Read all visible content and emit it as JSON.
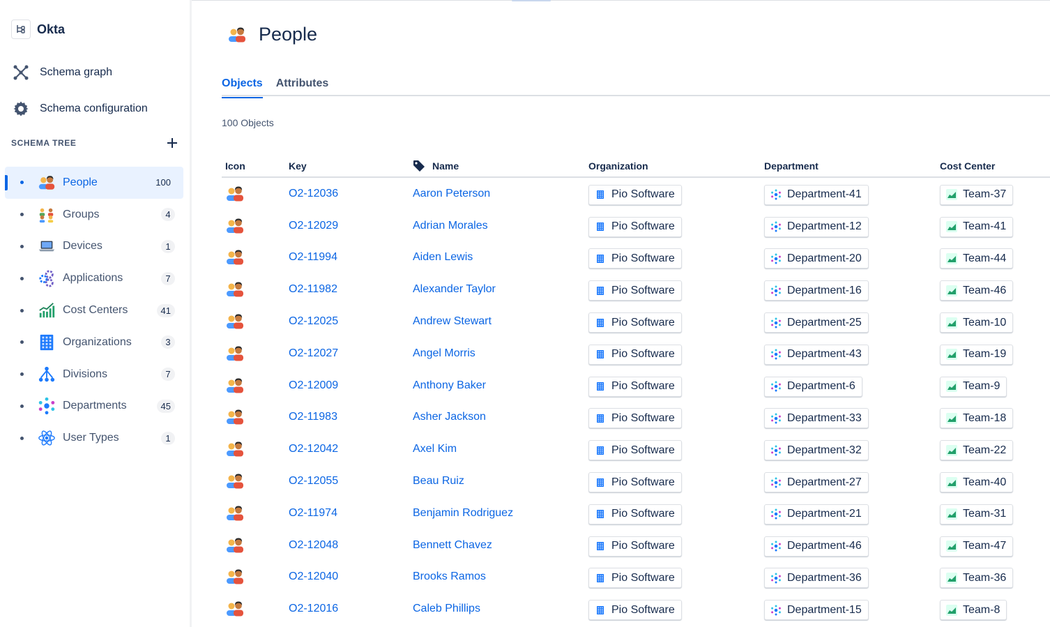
{
  "app": {
    "title": "Okta"
  },
  "nav": [
    {
      "label": "Schema graph",
      "icon": "schema-graph-icon"
    },
    {
      "label": "Schema configuration",
      "icon": "gear-icon"
    }
  ],
  "schema_tree": {
    "title": "SCHEMA TREE",
    "items": [
      {
        "label": "People",
        "count": "100",
        "icon": "people-icon",
        "active": true
      },
      {
        "label": "Groups",
        "count": "4",
        "icon": "groups-icon"
      },
      {
        "label": "Devices",
        "count": "1",
        "icon": "laptop-icon"
      },
      {
        "label": "Applications",
        "count": "7",
        "icon": "applications-icon"
      },
      {
        "label": "Cost Centers",
        "count": "41",
        "icon": "chart-icon"
      },
      {
        "label": "Organizations",
        "count": "3",
        "icon": "building-icon"
      },
      {
        "label": "Divisions",
        "count": "7",
        "icon": "hierarchy-icon"
      },
      {
        "label": "Departments",
        "count": "45",
        "icon": "departments-icon"
      },
      {
        "label": "User Types",
        "count": "1",
        "icon": "atom-icon"
      }
    ]
  },
  "page": {
    "title": "People",
    "tabs": [
      {
        "label": "Objects",
        "active": true
      },
      {
        "label": "Attributes"
      }
    ],
    "object_count": "100 Objects"
  },
  "table": {
    "columns": [
      "Icon",
      "Key",
      "Name",
      "Organization",
      "Department",
      "Cost Center"
    ],
    "rows": [
      {
        "key": "O2-12036",
        "name": "Aaron Peterson",
        "org": "Pio Software",
        "dept": "Department-41",
        "cost": "Team-37"
      },
      {
        "key": "O2-12029",
        "name": "Adrian Morales",
        "org": "Pio Software",
        "dept": "Department-12",
        "cost": "Team-41"
      },
      {
        "key": "O2-11994",
        "name": "Aiden Lewis",
        "org": "Pio Software",
        "dept": "Department-20",
        "cost": "Team-44"
      },
      {
        "key": "O2-11982",
        "name": "Alexander Taylor",
        "org": "Pio Software",
        "dept": "Department-16",
        "cost": "Team-46"
      },
      {
        "key": "O2-12025",
        "name": "Andrew Stewart",
        "org": "Pio Software",
        "dept": "Department-25",
        "cost": "Team-10"
      },
      {
        "key": "O2-12027",
        "name": "Angel Morris",
        "org": "Pio Software",
        "dept": "Department-43",
        "cost": "Team-19"
      },
      {
        "key": "O2-12009",
        "name": "Anthony Baker",
        "org": "Pio Software",
        "dept": "Department-6",
        "cost": "Team-9"
      },
      {
        "key": "O2-11983",
        "name": "Asher Jackson",
        "org": "Pio Software",
        "dept": "Department-33",
        "cost": "Team-18"
      },
      {
        "key": "O2-12042",
        "name": "Axel Kim",
        "org": "Pio Software",
        "dept": "Department-32",
        "cost": "Team-22"
      },
      {
        "key": "O2-12055",
        "name": "Beau Ruiz",
        "org": "Pio Software",
        "dept": "Department-27",
        "cost": "Team-40"
      },
      {
        "key": "O2-11974",
        "name": "Benjamin Rodriguez",
        "org": "Pio Software",
        "dept": "Department-21",
        "cost": "Team-31"
      },
      {
        "key": "O2-12048",
        "name": "Bennett Chavez",
        "org": "Pio Software",
        "dept": "Department-46",
        "cost": "Team-47"
      },
      {
        "key": "O2-12040",
        "name": "Brooks Ramos",
        "org": "Pio Software",
        "dept": "Department-36",
        "cost": "Team-36"
      },
      {
        "key": "O2-12016",
        "name": "Caleb Phillips",
        "org": "Pio Software",
        "dept": "Department-15",
        "cost": "Team-8"
      }
    ]
  },
  "colors": {
    "accent": "#0c66e4",
    "text": "#172b4d",
    "subtle": "#44546f",
    "active_bg": "#e9f2ff"
  }
}
